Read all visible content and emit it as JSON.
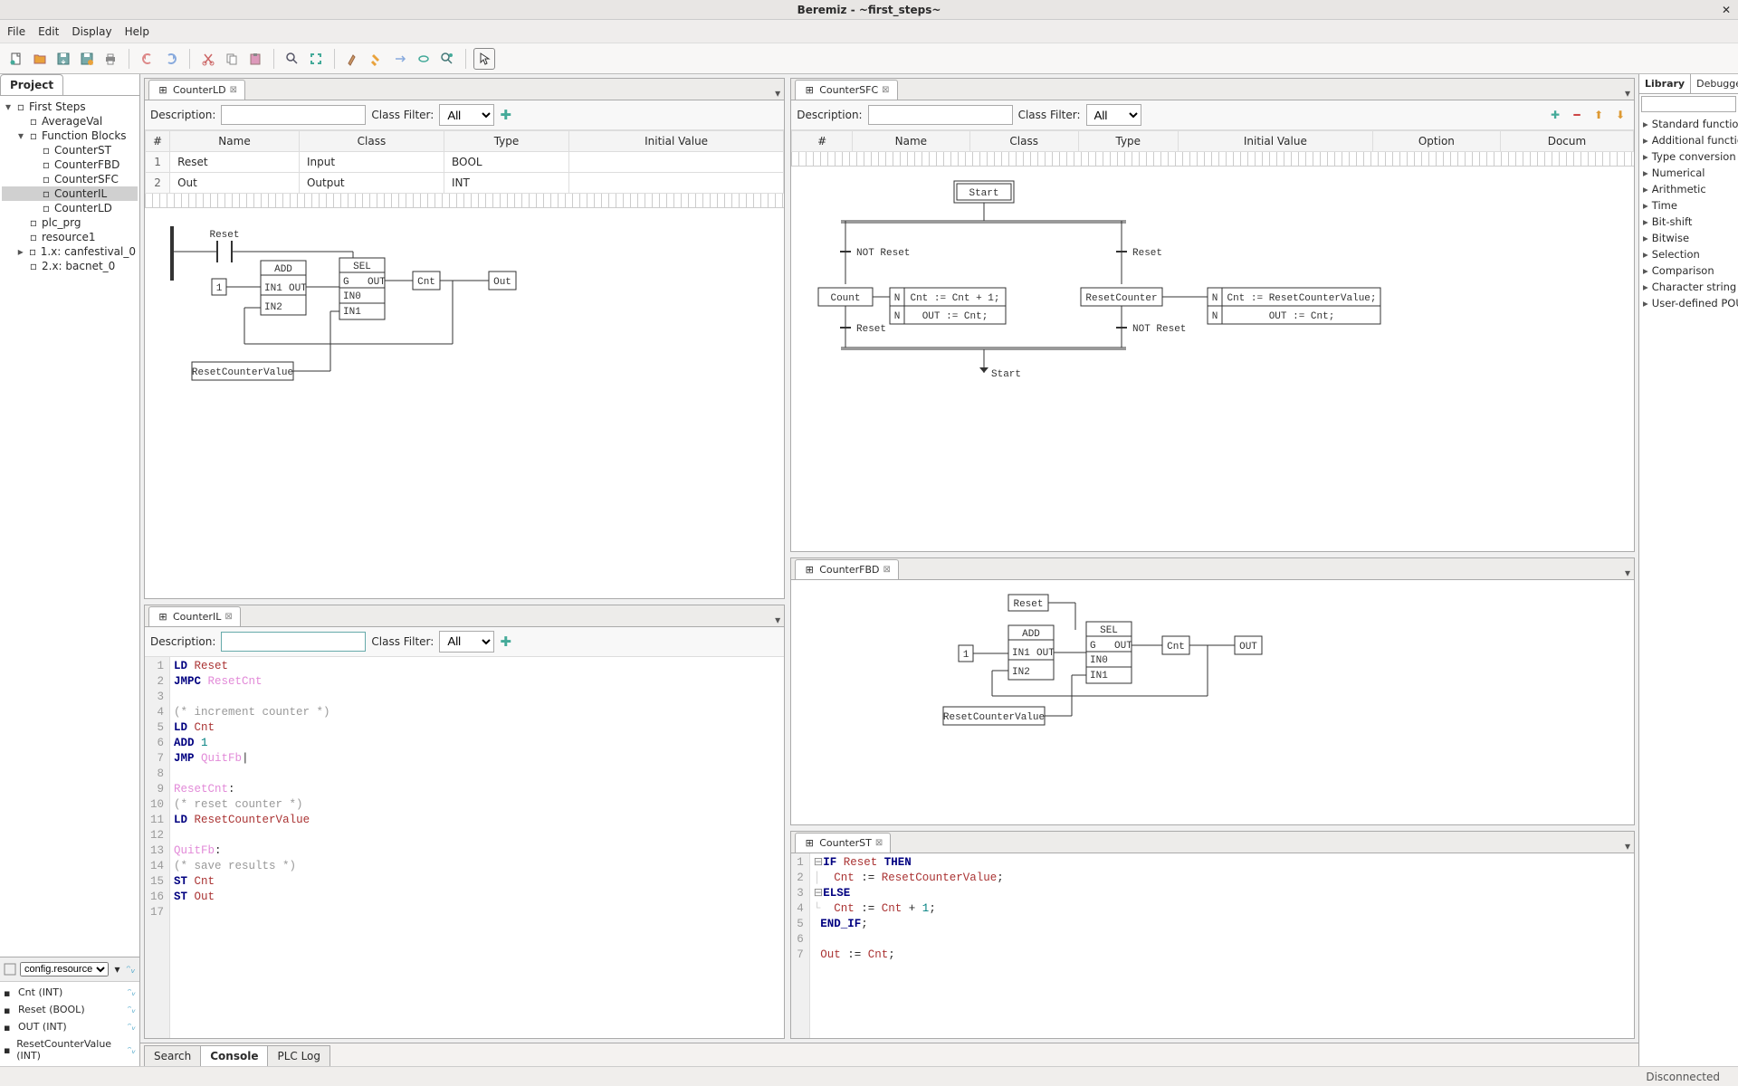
{
  "window": {
    "title": "Beremiz - ~first_steps~"
  },
  "menu": {
    "file": "File",
    "edit": "Edit",
    "display": "Display",
    "help": "Help"
  },
  "project": {
    "tab": "Project",
    "tree": [
      {
        "label": "First Steps",
        "indent": 0,
        "expander": "▾",
        "icon": "project"
      },
      {
        "label": "AverageVal",
        "indent": 1,
        "expander": "",
        "icon": "fnc"
      },
      {
        "label": "Function Blocks",
        "indent": 1,
        "expander": "▾",
        "icon": "folder"
      },
      {
        "label": "CounterST",
        "indent": 2,
        "expander": "",
        "icon": "st"
      },
      {
        "label": "CounterFBD",
        "indent": 2,
        "expander": "",
        "icon": "fbd"
      },
      {
        "label": "CounterSFC",
        "indent": 2,
        "expander": "",
        "icon": "sfc"
      },
      {
        "label": "CounterIL",
        "indent": 2,
        "expander": "",
        "icon": "il",
        "selected": true
      },
      {
        "label": "CounterLD",
        "indent": 2,
        "expander": "",
        "icon": "ld"
      },
      {
        "label": "plc_prg",
        "indent": 1,
        "expander": "",
        "icon": "prg"
      },
      {
        "label": "resource1",
        "indent": 1,
        "expander": "",
        "icon": "res"
      },
      {
        "label": "1.x: canfestival_0",
        "indent": 1,
        "expander": "▸",
        "icon": "ext"
      },
      {
        "label": "2.x: bacnet_0",
        "indent": 1,
        "expander": "",
        "icon": "ext"
      }
    ]
  },
  "varpanel": {
    "selector": "config.resource",
    "items": [
      {
        "label": "Cnt (INT)"
      },
      {
        "label": "Reset (BOOL)"
      },
      {
        "label": "OUT (INT)"
      },
      {
        "label": "ResetCounterValue (INT)"
      }
    ]
  },
  "editors": {
    "ld": {
      "tab": "CounterLD",
      "desc_label": "Description:",
      "filter_label": "Class Filter:",
      "filter_value": "All",
      "columns": [
        "#",
        "Name",
        "Class",
        "Type",
        "Initial Value"
      ],
      "rows": [
        [
          "1",
          "Reset",
          "Input",
          "BOOL",
          ""
        ],
        [
          "2",
          "Out",
          "Output",
          "INT",
          ""
        ]
      ],
      "fbd": {
        "reset": "Reset",
        "add": "ADD",
        "in1": "IN1",
        "in2": "IN2",
        "out": "OUT",
        "sel": "SEL",
        "g": "G",
        "in0": "IN0",
        "cnt": "Cnt",
        "outblk": "Out",
        "rcv": "ResetCounterValue",
        "one": "1"
      }
    },
    "il": {
      "tab": "CounterIL",
      "desc_label": "Description:",
      "filter_label": "Class Filter:",
      "filter_value": "All",
      "lines": 17
    },
    "sfc": {
      "tab": "CounterSFC",
      "desc_label": "Description:",
      "filter_label": "Class Filter:",
      "filter_value": "All",
      "columns": [
        "#",
        "Name",
        "Class",
        "Type",
        "Initial Value",
        "Option",
        "Docum"
      ],
      "labels": {
        "start": "Start",
        "not_reset": "NOT Reset",
        "reset": "Reset",
        "count": "Count",
        "resetcounter": "ResetCounter",
        "n": "N",
        "inc": "Cnt := Cnt + 1;",
        "outcnt": "OUT := Cnt;",
        "rcv": "Cnt := ResetCounterValue;",
        "start2": "Start"
      }
    },
    "fbd": {
      "tab": "CounterFBD",
      "labels": {
        "reset": "Reset",
        "one": "1",
        "add": "ADD",
        "in1": "IN1",
        "in2": "IN2",
        "out": "OUT",
        "sel": "SEL",
        "g": "G",
        "in0": "IN0",
        "cnt": "Cnt",
        "rcv": "ResetCounterValue"
      }
    },
    "st": {
      "tab": "CounterST"
    }
  },
  "library": {
    "tab1": "Library",
    "tab2": "Debugger",
    "items": [
      "Standard function",
      "Additional function",
      "Type conversion",
      "Numerical",
      "Arithmetic",
      "Time",
      "Bit-shift",
      "Bitwise",
      "Selection",
      "Comparison",
      "Character string",
      "User-defined POU"
    ]
  },
  "bottom": {
    "search": "Search",
    "console": "Console",
    "plclog": "PLC Log"
  },
  "status": {
    "text": "Disconnected"
  }
}
